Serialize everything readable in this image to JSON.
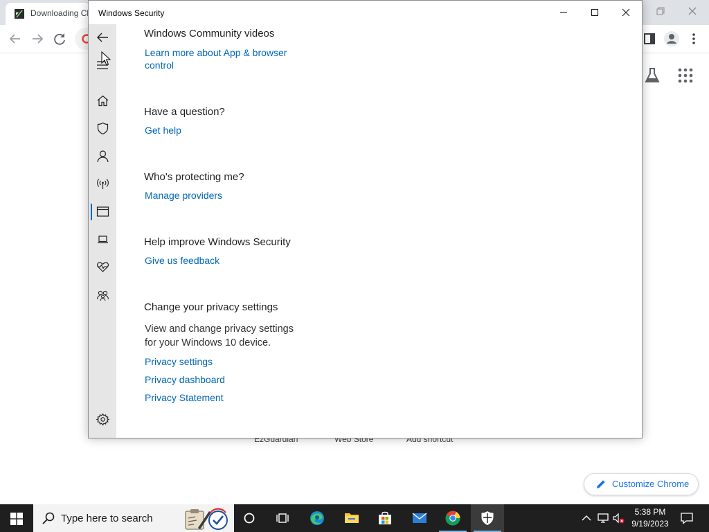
{
  "chrome": {
    "tab_title": "Downloading Chrome",
    "shortcuts": [
      {
        "label": "EzGuardian"
      },
      {
        "label": "Web Store"
      },
      {
        "label": "Add shortcut"
      }
    ],
    "customize_label": "Customize Chrome"
  },
  "window": {
    "title": "Windows Security",
    "sidebar_items": [
      {
        "name": "home-icon"
      },
      {
        "name": "shield-icon"
      },
      {
        "name": "person-icon"
      },
      {
        "name": "wifi-antenna-icon"
      },
      {
        "name": "app-browser-icon",
        "active": true
      },
      {
        "name": "laptop-icon"
      },
      {
        "name": "heart-pulse-icon"
      },
      {
        "name": "family-icon"
      },
      {
        "name": "gear-icon"
      }
    ],
    "sections": [
      {
        "heading": "Windows Community videos",
        "links": [
          "Learn more about App & browser",
          "control"
        ]
      },
      {
        "heading": "Have a question?",
        "links": [
          "Get help"
        ]
      },
      {
        "heading": "Who's protecting me?",
        "links": [
          "Manage providers"
        ]
      },
      {
        "heading": "Help improve Windows Security",
        "links": [
          "Give us feedback"
        ]
      },
      {
        "heading": "Change your privacy settings",
        "body": [
          "View and change privacy settings",
          "for your Windows 10 device."
        ],
        "links": [
          "Privacy settings",
          "Privacy dashboard",
          "Privacy Statement"
        ]
      }
    ]
  },
  "taskbar": {
    "search_placeholder": "Type here to search",
    "search_art": "",
    "apps": [
      {
        "name": "cortana-icon"
      },
      {
        "name": "task-view-icon"
      },
      {
        "name": "edge-icon"
      },
      {
        "name": "file-explorer-icon"
      },
      {
        "name": "microsoft-store-icon"
      },
      {
        "name": "mail-icon"
      },
      {
        "name": "chrome-icon",
        "running": true
      },
      {
        "name": "windows-security-icon",
        "running": true,
        "active": true
      }
    ],
    "time": "5:38 PM",
    "date": "9/19/2023"
  },
  "colors": {
    "link": "#0067b8",
    "sidebar_bg": "#e6e6e6",
    "taskbar_bg": "#1f1f1f",
    "chrome_accent": "#1a73e8"
  }
}
